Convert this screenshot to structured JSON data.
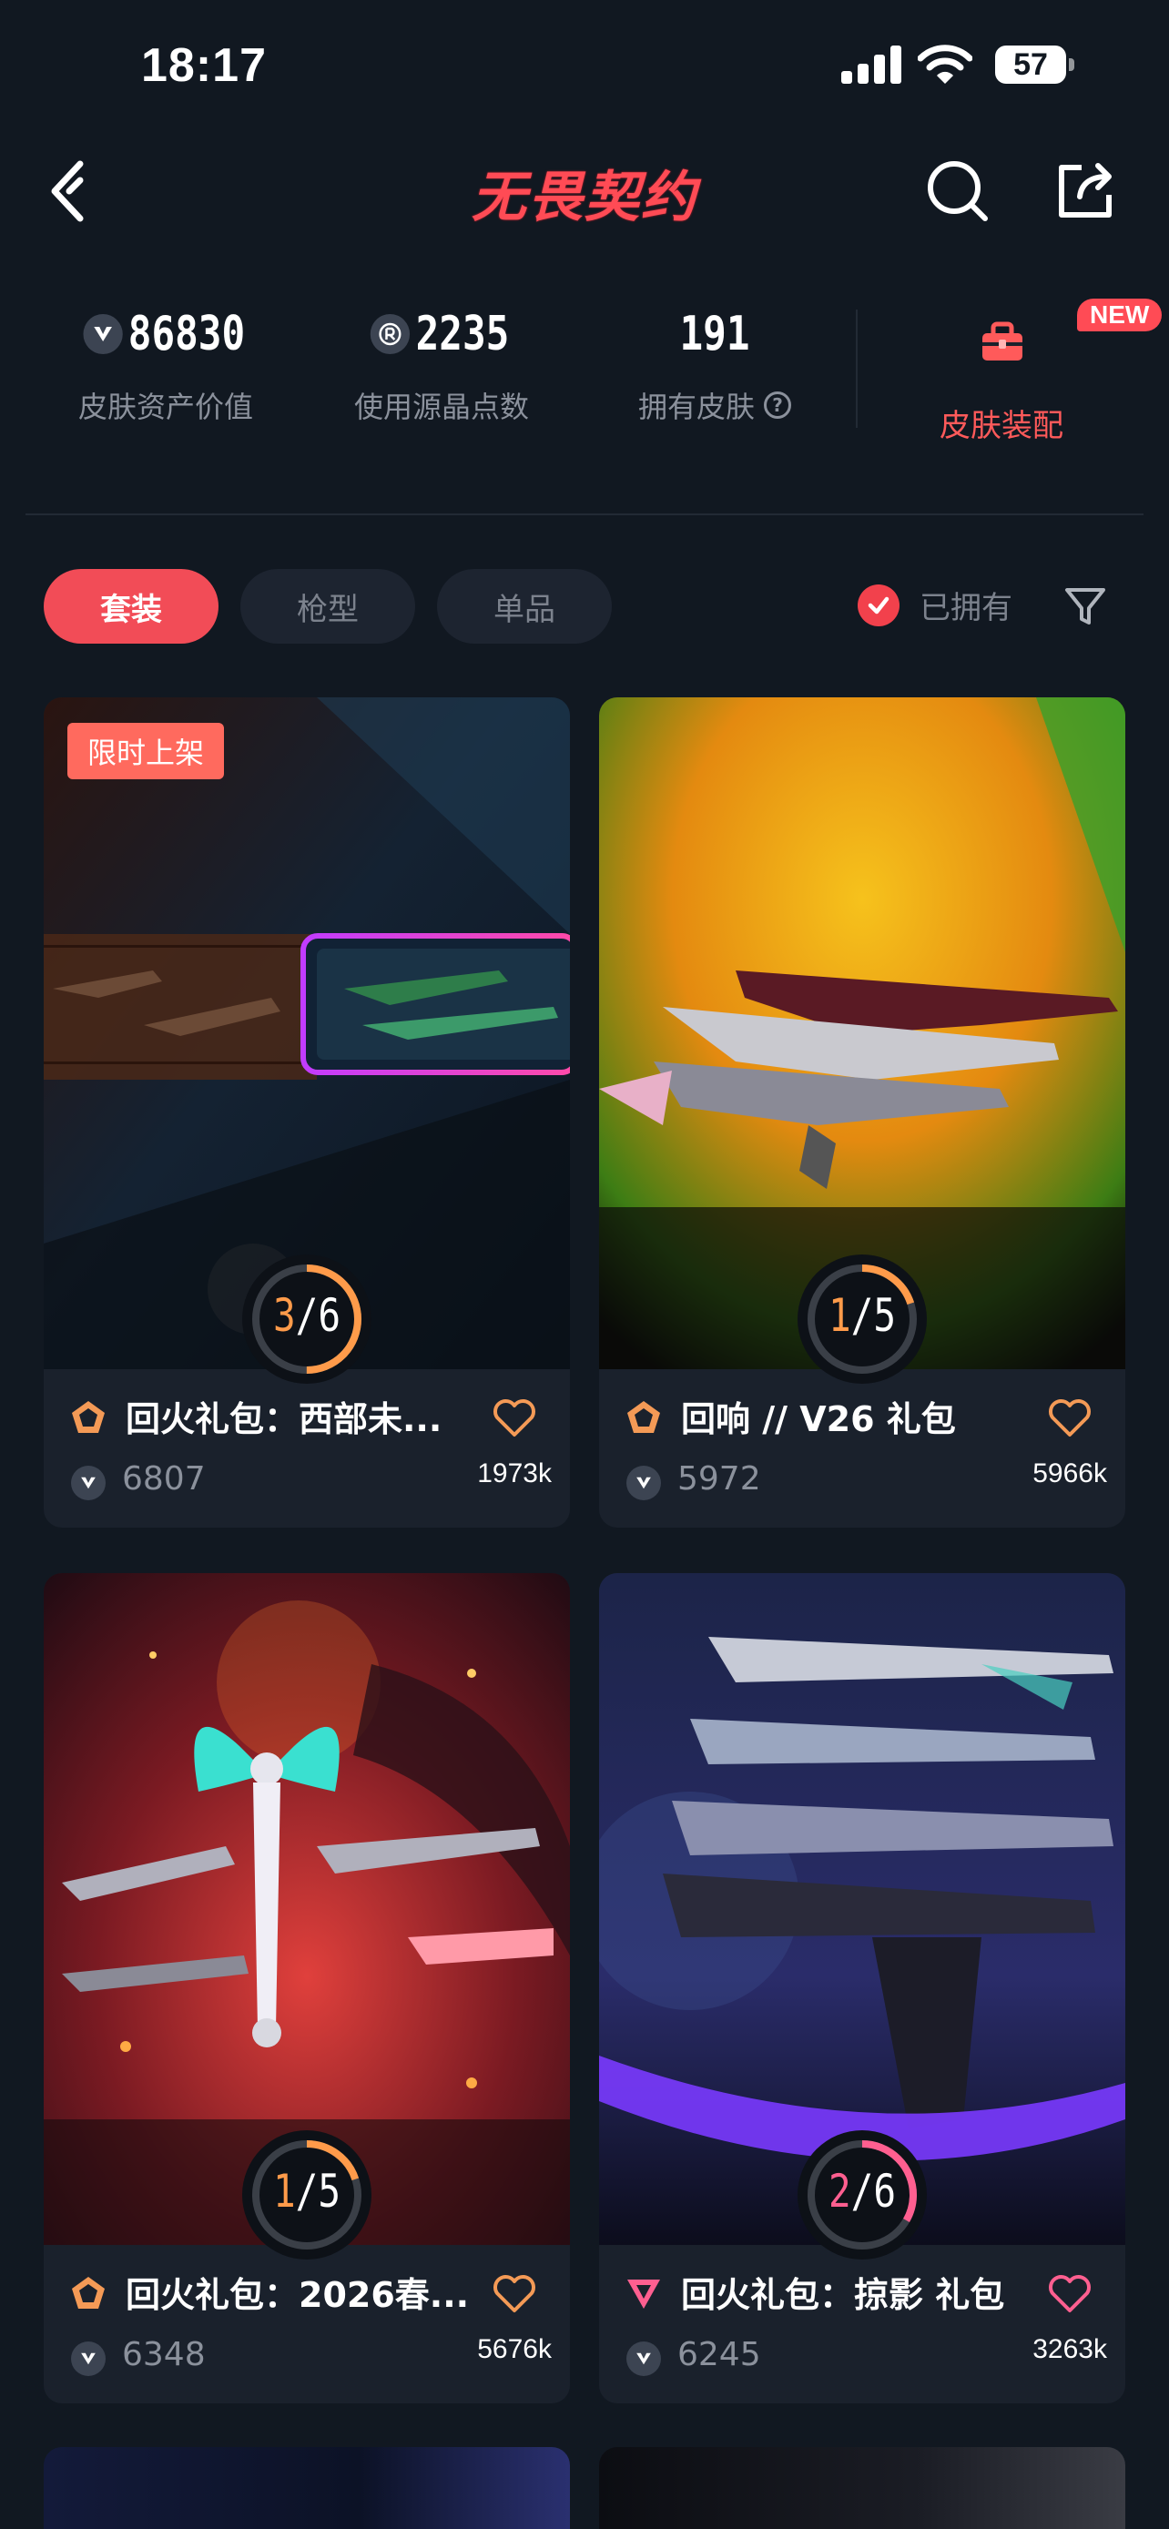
{
  "status": {
    "time": "18:17",
    "battery": "57"
  },
  "nav": {
    "title": "无畏契约"
  },
  "stats": [
    {
      "value": "86830",
      "label": "皮肤资产价值",
      "icon": "valorant-points-icon"
    },
    {
      "value": "2235",
      "label": "使用源晶点数",
      "icon": "radianite-icon"
    },
    {
      "value": "191",
      "label": "拥有皮肤",
      "icon": "help-icon"
    }
  ],
  "skin_setup": {
    "label": "皮肤装配",
    "badge": "NEW",
    "icon": "briefcase-icon"
  },
  "filters": {
    "tabs": [
      "套装",
      "枪型",
      "单品"
    ],
    "active_tab": "套装",
    "owned_label": "已拥有",
    "owned_checked": true
  },
  "colors": {
    "accent": "#f24c57",
    "background": "#111821",
    "card": "#1a212c",
    "progress_orange": "#ff9b4a",
    "progress_pink": "#ff5f90"
  },
  "cards": [
    {
      "tag": "限时上架",
      "title": "回火礼包：西部未...",
      "owned": "3",
      "total": "6",
      "progress": 0.5,
      "price": "6807",
      "likes": "1973k",
      "tier": "premium",
      "tier_icon": "pentagon-tier-icon"
    },
    {
      "tag": "",
      "title": "回响 // V26 礼包",
      "owned": "1",
      "total": "5",
      "progress": 0.2,
      "price": "5972",
      "likes": "5966k",
      "tier": "premium",
      "tier_icon": "pentagon-tier-icon"
    },
    {
      "tag": "",
      "title": "回火礼包：2026春...",
      "owned": "1",
      "total": "5",
      "progress": 0.2,
      "price": "6348",
      "likes": "5676k",
      "tier": "premium",
      "tier_icon": "pentagon-tier-icon"
    },
    {
      "tag": "",
      "title": "回火礼包：掠影 礼包",
      "owned": "2",
      "total": "6",
      "progress": 0.333,
      "price": "6245",
      "likes": "3263k",
      "tier": "exclusive",
      "tier_icon": "triangle-tier-icon"
    }
  ]
}
